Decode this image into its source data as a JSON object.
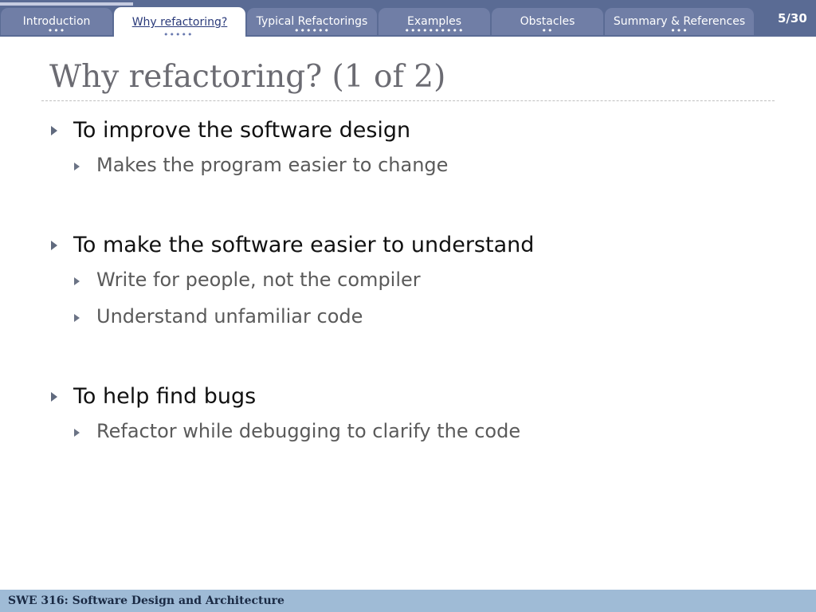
{
  "nav": {
    "progress": 0.1633,
    "tabs": [
      {
        "label": "Introduction",
        "dots": "•••",
        "active": false
      },
      {
        "label": "Why refactoring?",
        "dots": "•••••",
        "active": true
      },
      {
        "label": "Typical Refactorings",
        "dots": "••••••",
        "active": false
      },
      {
        "label": "Examples",
        "dots": "••••••••••",
        "active": false
      },
      {
        "label": "Obstacles",
        "dots": "••",
        "active": false
      },
      {
        "label": "Summary & References",
        "dots": "•••",
        "active": false
      }
    ],
    "page_indicator": "5/30"
  },
  "slide": {
    "title": "Why refactoring? (1 of 2)",
    "bullets": [
      {
        "text": "To improve the software design",
        "subs": [
          "Makes the program easier to change"
        ]
      },
      {
        "text": "To make the software easier to understand",
        "subs": [
          "Write for people, not the compiler",
          "Understand unfamiliar code"
        ]
      },
      {
        "text": "To help find bugs",
        "subs": [
          "Refactor while debugging to clarify the code"
        ]
      }
    ]
  },
  "footer": {
    "course": "SWE 316: Software Design and Architecture"
  },
  "colors": {
    "nav_bg": "#5a6b94",
    "tab_bg": "#707ea6",
    "active_tab_text": "#2a3a7a",
    "footer_bg": "#9fbbd6"
  }
}
